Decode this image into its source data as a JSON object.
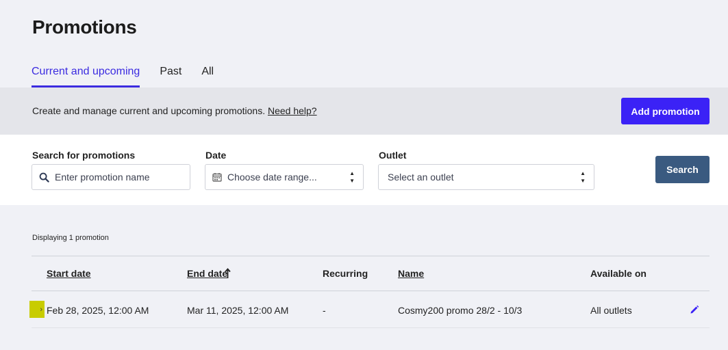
{
  "page": {
    "title": "Promotions"
  },
  "tabs": [
    {
      "label": "Current and upcoming",
      "active": true
    },
    {
      "label": "Past",
      "active": false
    },
    {
      "label": "All",
      "active": false
    }
  ],
  "banner": {
    "text": "Create and manage current and upcoming promotions.",
    "help_link": "Need help?",
    "add_button": "Add promotion"
  },
  "filters": {
    "search": {
      "label": "Search for promotions",
      "placeholder": "Enter promotion name"
    },
    "date": {
      "label": "Date",
      "placeholder": "Choose date range..."
    },
    "outlet": {
      "label": "Outlet",
      "placeholder": "Select an outlet"
    },
    "search_button": "Search"
  },
  "results": {
    "count_text": "Displaying 1 promotion"
  },
  "table": {
    "headers": {
      "start_date": "Start date",
      "end_date": "End date",
      "recurring": "Recurring",
      "name": "Name",
      "available_on": "Available on"
    },
    "rows": [
      {
        "start_date": "Feb 28, 2025, 12:00 AM",
        "end_date": "Mar 11, 2025, 12:00 AM",
        "recurring": "-",
        "name": "Cosmy200 promo 28/2 - 10/3",
        "available_on": "All outlets"
      }
    ]
  },
  "colors": {
    "accent": "#3b22f6",
    "tab_active": "#3b2be0",
    "search_button": "#3a5a80",
    "expander_highlight": "#c8cc00"
  },
  "icons": {
    "search": "search-icon",
    "calendar": "calendar-icon",
    "sort": "sort-arrow-up-icon",
    "expand": "chevron-right-icon",
    "edit": "pencil-icon"
  }
}
